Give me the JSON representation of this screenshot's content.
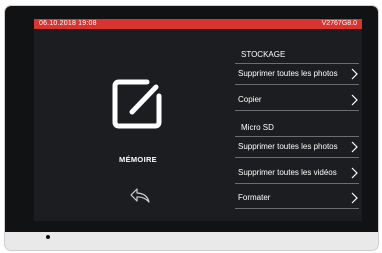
{
  "statusbar": {
    "datetime": "06.10.2018  19:08",
    "version": "V2767G8.0"
  },
  "left_panel": {
    "title": "MÉMOIRE",
    "icon": "edit-memory-icon",
    "back_icon": "back-arrow-icon"
  },
  "storage": {
    "header": "STOCKAGE",
    "items": [
      {
        "label": "Supprimer toutes les photos"
      },
      {
        "label": "Copier"
      }
    ]
  },
  "micro_sd": {
    "header": "Micro SD",
    "items": [
      {
        "label": "Supprimer toutes les photos"
      },
      {
        "label": "Supprimer toutes les vidéos"
      },
      {
        "label": "Formater"
      }
    ]
  },
  "colors": {
    "accent": "#d9342f",
    "screen_bg": "#1c1d20",
    "bezel": "#111214",
    "divider": "#6b6d72"
  }
}
